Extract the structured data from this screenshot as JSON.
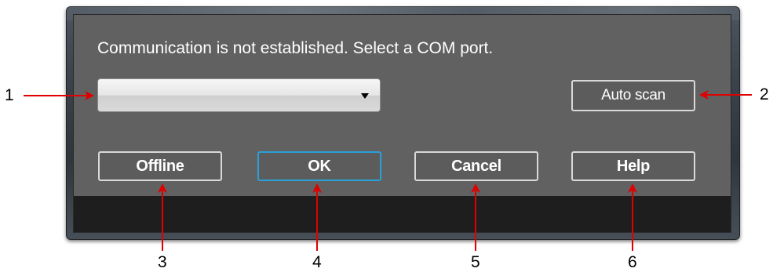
{
  "dialog": {
    "message": "Communication is not established. Select a COM port.",
    "com_port_value": "",
    "buttons": {
      "auto_scan": "Auto scan",
      "offline": "Offline",
      "ok": "OK",
      "cancel": "Cancel",
      "help": "Help"
    }
  },
  "callouts": {
    "c1": "1",
    "c2": "2",
    "c3": "3",
    "c4": "4",
    "c5": "5",
    "c6": "6",
    "arrow_color": "#e00000"
  }
}
